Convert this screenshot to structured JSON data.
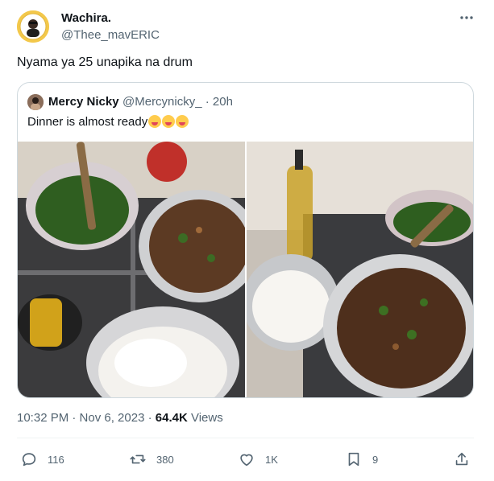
{
  "author": {
    "name": "Wachira.",
    "handle": "@Thee_mavERIC",
    "avatar_icon": "avatar-portrait-icon"
  },
  "tweet": {
    "text": "Nyama ya 25 unapika na drum"
  },
  "quote": {
    "name": "Mercy Nicky",
    "handle": "@Mercynicky_ · 20h",
    "text": "Dinner is almost ready",
    "emoji_icon": "face-savoring-food-emoji"
  },
  "meta": {
    "timestamp": "10:32 PM · Nov 6, 2023 · ",
    "views_count": "64.4K",
    "views_label": " Views"
  },
  "actions": {
    "replies": "116",
    "reposts": "380",
    "likes": "1K",
    "bookmarks": "9"
  },
  "colors": {
    "text": "#0f1419",
    "secondary": "#536471",
    "border": "#cfd9de"
  }
}
